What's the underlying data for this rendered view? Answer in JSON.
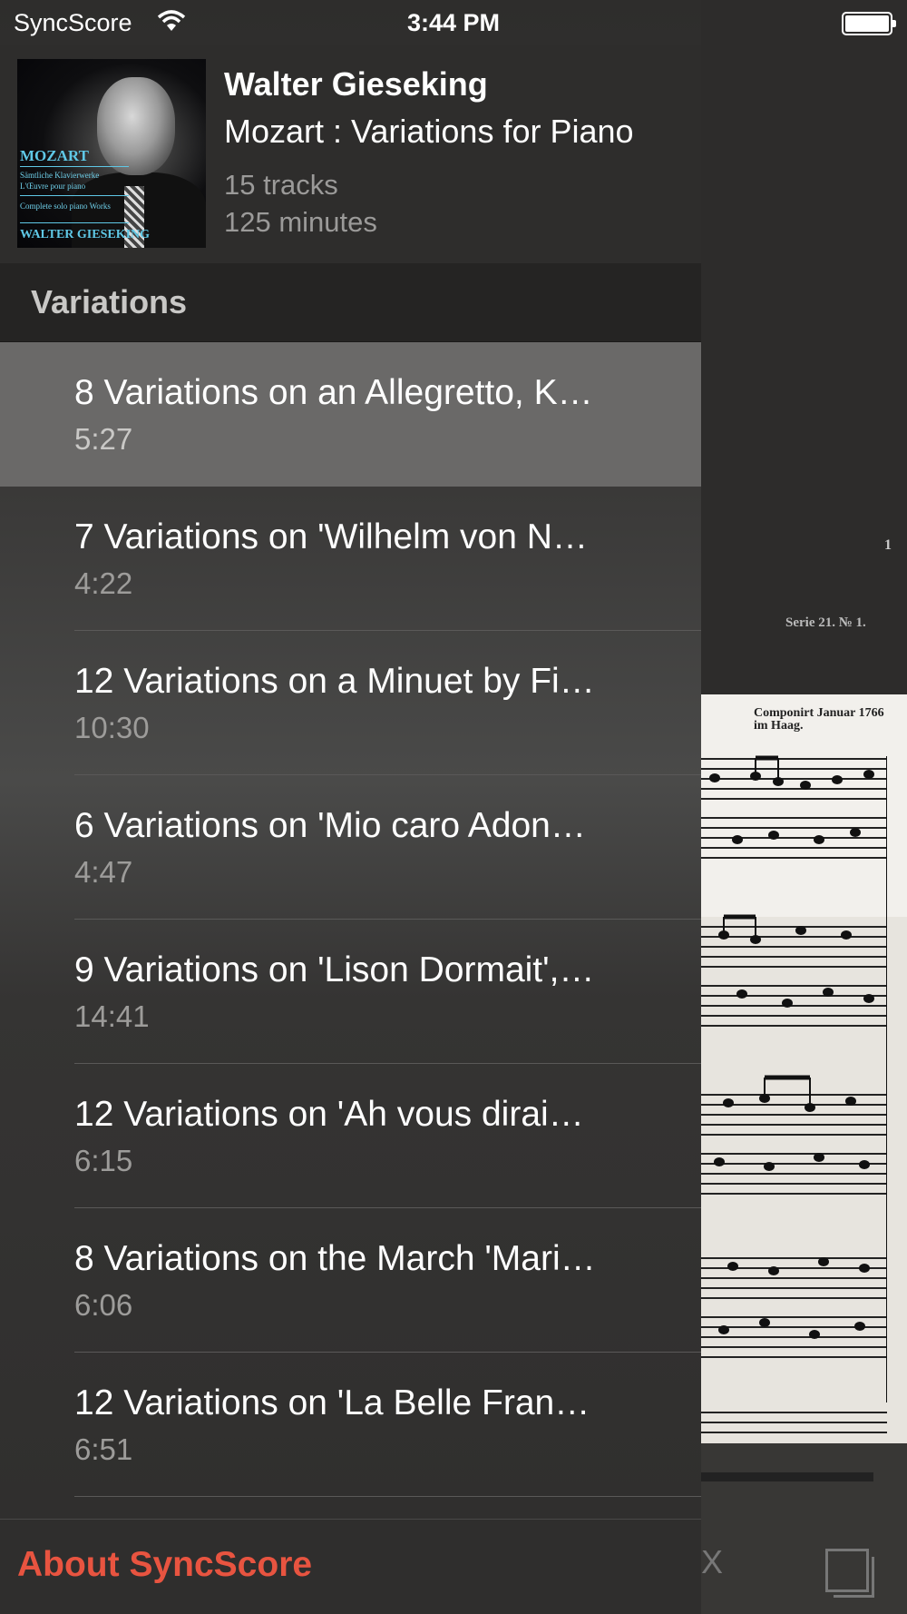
{
  "status_bar": {
    "carrier": "SyncScore",
    "time": "3:44 PM"
  },
  "album": {
    "artist": "Walter Gieseking",
    "title": "Mozart : Variations for Piano",
    "tracks": "15 tracks",
    "duration": "125 minutes",
    "art": {
      "composer": "MOZART",
      "line1": "Sämtliche Klavierwerke",
      "line2": "L'Œuvre pour piano",
      "line3": "Complete solo piano Works",
      "performer": "WALTER GIESEKING"
    }
  },
  "section": {
    "title": "Variations"
  },
  "track_list": [
    {
      "title": "8 Variations on an Allegretto, K…",
      "duration": "5:27",
      "selected": true
    },
    {
      "title": "7 Variations on 'Wilhelm von N…",
      "duration": "4:22",
      "selected": false
    },
    {
      "title": "12 Variations on a Minuet by Fi…",
      "duration": "10:30",
      "selected": false
    },
    {
      "title": "6 Variations on 'Mio caro Adon…",
      "duration": "4:47",
      "selected": false
    },
    {
      "title": "9 Variations on 'Lison Dormait',…",
      "duration": "14:41",
      "selected": false
    },
    {
      "title": "12 Variations on 'Ah vous dirai…",
      "duration": "6:15",
      "selected": false
    },
    {
      "title": "8 Variations on the March 'Mari…",
      "duration": "6:06",
      "selected": false
    },
    {
      "title": "12 Variations on 'La Belle Fran…",
      "duration": "6:51",
      "selected": false
    }
  ],
  "footer": {
    "about_label": "About SyncScore"
  },
  "score_background": {
    "page_number": "1",
    "series_label": "Serie 21. № 1.",
    "composition_note_1": "Componirt Januar 1766",
    "composition_note_2": "im Haag."
  },
  "colors": {
    "accent": "#e85440",
    "selected_row": "#6a6968"
  }
}
